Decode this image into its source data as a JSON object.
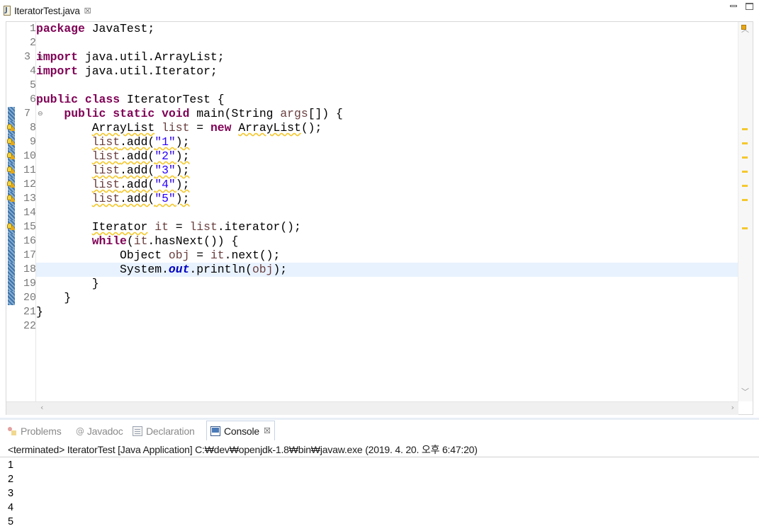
{
  "editor_tab": {
    "title": "IteratorTest.java",
    "icon": "java-file-icon"
  },
  "editor": {
    "current_line": 18,
    "lines": [
      {
        "n": "1"
      },
      {
        "n": "2"
      },
      {
        "n": "3"
      },
      {
        "n": "4"
      },
      {
        "n": "5"
      },
      {
        "n": "6"
      },
      {
        "n": "7"
      },
      {
        "n": "8"
      },
      {
        "n": "9"
      },
      {
        "n": "10"
      },
      {
        "n": "11"
      },
      {
        "n": "12"
      },
      {
        "n": "13"
      },
      {
        "n": "14"
      },
      {
        "n": "15"
      },
      {
        "n": "16"
      },
      {
        "n": "17"
      },
      {
        "n": "18"
      },
      {
        "n": "19"
      },
      {
        "n": "20"
      },
      {
        "n": "21"
      },
      {
        "n": "22"
      }
    ],
    "tokens": {
      "package_kw": "package",
      "package_name": " JavaTest;",
      "import_kw": "import",
      "import1": " java.util.ArrayList;",
      "import2": " java.util.Iterator;",
      "public_kw": "public",
      "class_kw": "class",
      "class_name": " IteratorTest {",
      "static_kw": "static",
      "void_kw": "void",
      "main_sig_a": " main(String ",
      "args": "args",
      "main_sig_b": "[]) {",
      "arraylist_type": "ArrayList",
      "list_var": "list",
      "assign": " = ",
      "new_kw": "new",
      "arraylist_ctor": "ArrayList",
      "ctor_end": "();",
      "add_call": ".add(",
      "add_end": ");",
      "s1": "\"1\"",
      "s2": "\"2\"",
      "s3": "\"3\"",
      "s4": "\"4\"",
      "s5": "\"5\"",
      "iterator_type": "Iterator",
      "it_var": "it",
      "iterator_call": ".iterator();",
      "while_kw": "while",
      "paren_open": "(",
      "hasnext": ".hasNext()) {",
      "object_type": "Object",
      "obj_var": "obj",
      "next_call": ".next();",
      "system": "System.",
      "out": "out",
      "println": ".println(",
      "println_end": ");",
      "close1": "}",
      "close2": "}",
      "close3": "}"
    }
  },
  "panel": {
    "tabs": [
      {
        "label": "Problems",
        "icon": "problems-icon",
        "active": false
      },
      {
        "label": "Javadoc",
        "icon": "javadoc-icon",
        "active": false
      },
      {
        "label": "Declaration",
        "icon": "declaration-icon",
        "active": false
      },
      {
        "label": "Console",
        "icon": "console-icon",
        "active": true
      }
    ],
    "javadoc_at": "@",
    "close_glyph": "☒",
    "terminated": "<terminated> IteratorTest [Java Application] C:₩dev₩openjdk-1.8₩bin₩javaw.exe (2019. 4. 20. 오후 6:47:20)",
    "output": [
      "1",
      "2",
      "3",
      "4",
      "5"
    ]
  },
  "colors": {
    "keyword": "#7f0055",
    "string": "#2a00ff",
    "field": "#0000c0",
    "local_var": "#6a3e3e",
    "current_line": "#e8f2fe",
    "warning": "#f4c82d"
  }
}
